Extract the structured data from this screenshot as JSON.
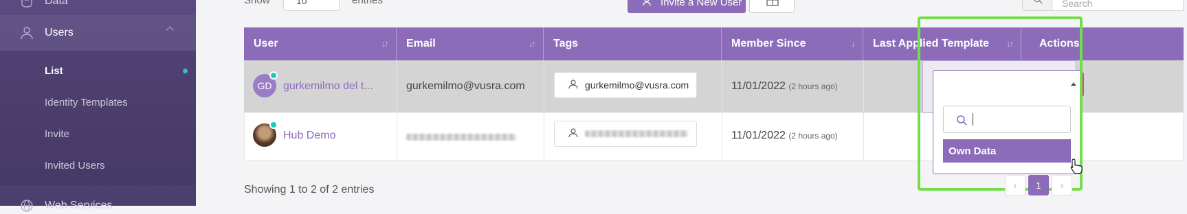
{
  "sidebar": {
    "items": [
      {
        "label": "Data",
        "icon": "database-icon"
      },
      {
        "label": "Users",
        "icon": "user-icon"
      },
      {
        "label": "Web Services",
        "icon": "globe-icon"
      }
    ],
    "users_sub": [
      {
        "label": "List",
        "active": true
      },
      {
        "label": "Identity Templates"
      },
      {
        "label": "Invite"
      },
      {
        "label": "Invited Users"
      }
    ]
  },
  "toolbar": {
    "show_label": "Show",
    "length_value": "10",
    "entries_label": "entries",
    "invite_label": "Invite a New User",
    "search_placeholder": "Search"
  },
  "table": {
    "headers": [
      "User",
      "Email",
      "Tags",
      "Member Since",
      "Last Applied Template",
      "Actions"
    ],
    "rows": [
      {
        "avatar_initials": "GD",
        "name": "gurkemilmo del t...",
        "email": "gurkemilmo@vusra.com",
        "tag": "gurkemilmo@vusra.com",
        "member_date": "11/01/2022",
        "member_ago": "(2 hours ago)"
      },
      {
        "avatar_initials": "",
        "name": "Hub Demo",
        "email": "",
        "tag": "",
        "member_date": "11/01/2022",
        "member_ago": "(2 hours ago)"
      }
    ]
  },
  "dropdown": {
    "search_value": "",
    "option": "Own Data"
  },
  "footer": {
    "info": "Showing 1 to 2 of 2 entries",
    "page": "1",
    "prev": "‹",
    "next": "›"
  },
  "colors": {
    "accent": "#8c6cb9",
    "sidebar": "#4b3d6e",
    "highlight": "#74dd4a",
    "edit": "#2a9df4",
    "delete": "#ee3d8f"
  }
}
